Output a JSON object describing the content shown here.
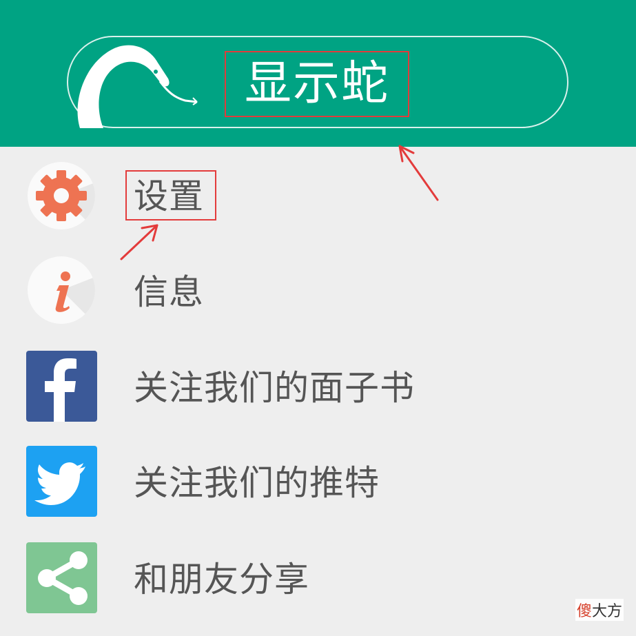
{
  "header": {
    "title": "显示蛇",
    "logo_icon": "snake-icon",
    "background": "#00a383"
  },
  "menu": {
    "items": [
      {
        "label": "设置",
        "icon": "gear-icon"
      },
      {
        "label": "信息",
        "icon": "info-icon"
      },
      {
        "label": "关注我们的面子书",
        "icon": "facebook-icon"
      },
      {
        "label": "关注我们的推特",
        "icon": "twitter-icon"
      },
      {
        "label": "和朋友分享",
        "icon": "share-icon"
      }
    ]
  },
  "annotations": {
    "highlight_color": "#e33b3b"
  },
  "watermark": {
    "first_char": "傻",
    "rest": "大方"
  },
  "colors": {
    "gear": "#ee7352",
    "info": "#ee7352",
    "facebook": "#3b5998",
    "twitter": "#1da1f2",
    "share": "#7fc693"
  }
}
